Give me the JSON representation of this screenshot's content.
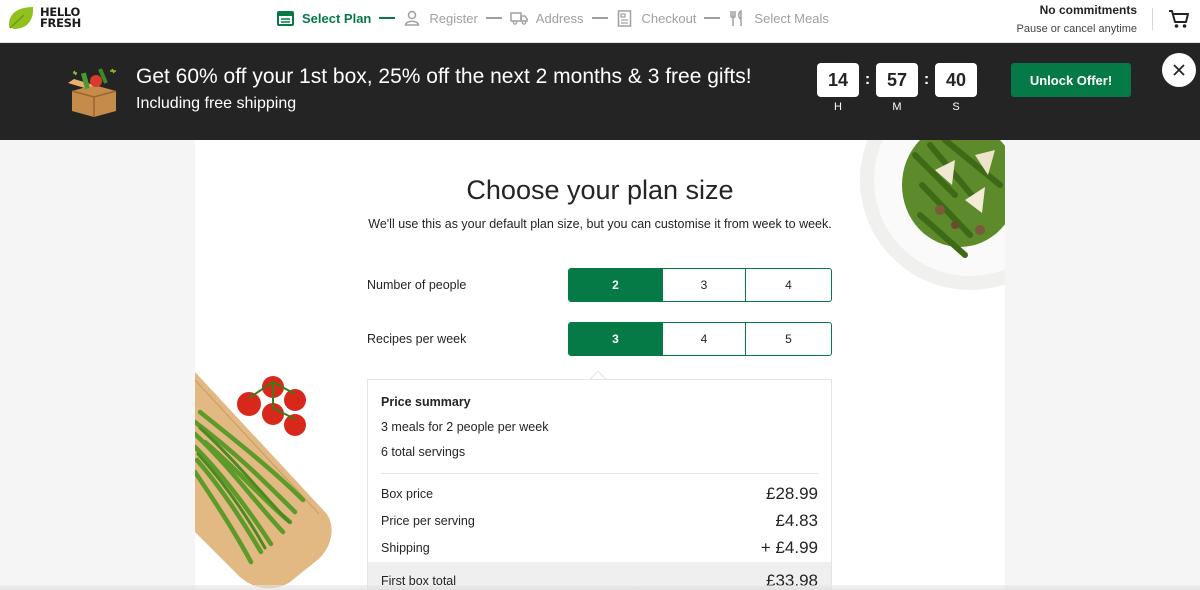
{
  "brand": {
    "line1": "HELLO",
    "line2": "FRESH"
  },
  "steps": [
    {
      "label": "Select Plan",
      "icon": "plan-icon",
      "active": true
    },
    {
      "label": "Register",
      "icon": "user-icon",
      "active": false
    },
    {
      "label": "Address",
      "icon": "truck-icon",
      "active": false
    },
    {
      "label": "Checkout",
      "icon": "receipt-icon",
      "active": false
    },
    {
      "label": "Select Meals",
      "icon": "cutlery-icon",
      "active": false
    }
  ],
  "header": {
    "commit_title": "No commitments",
    "commit_sub": "Pause or cancel anytime"
  },
  "promo": {
    "title": "Get 60% off your 1st box, 25% off the next 2 months & 3 free gifts!",
    "subtitle": "Including free shipping",
    "timer": {
      "hours": "14",
      "minutes": "57",
      "seconds": "40",
      "h_label": "H",
      "m_label": "M",
      "s_label": "S"
    },
    "button": "Unlock Offer!"
  },
  "plan": {
    "title": "Choose your plan size",
    "subtitle": "We'll use this as your default plan size, but you can customise it from week to week.",
    "people": {
      "label": "Number of people",
      "options": [
        "2",
        "3",
        "4"
      ],
      "selected": "2"
    },
    "recipes": {
      "label": "Recipes per week",
      "options": [
        "3",
        "4",
        "5"
      ],
      "selected": "3"
    }
  },
  "summary": {
    "title": "Price summary",
    "line1": "3 meals for 2 people per week",
    "line2": "6 total servings",
    "box_price_label": "Box price",
    "box_price": "£28.99",
    "per_serving_label": "Price per serving",
    "per_serving": "£4.83",
    "shipping_label": "Shipping",
    "shipping": "+ £4.99",
    "total_label": "First box total",
    "total": "£33.98"
  },
  "colors": {
    "brand_green": "#067a46",
    "logo_green": "#91c11e",
    "banner_bg": "#242424"
  }
}
